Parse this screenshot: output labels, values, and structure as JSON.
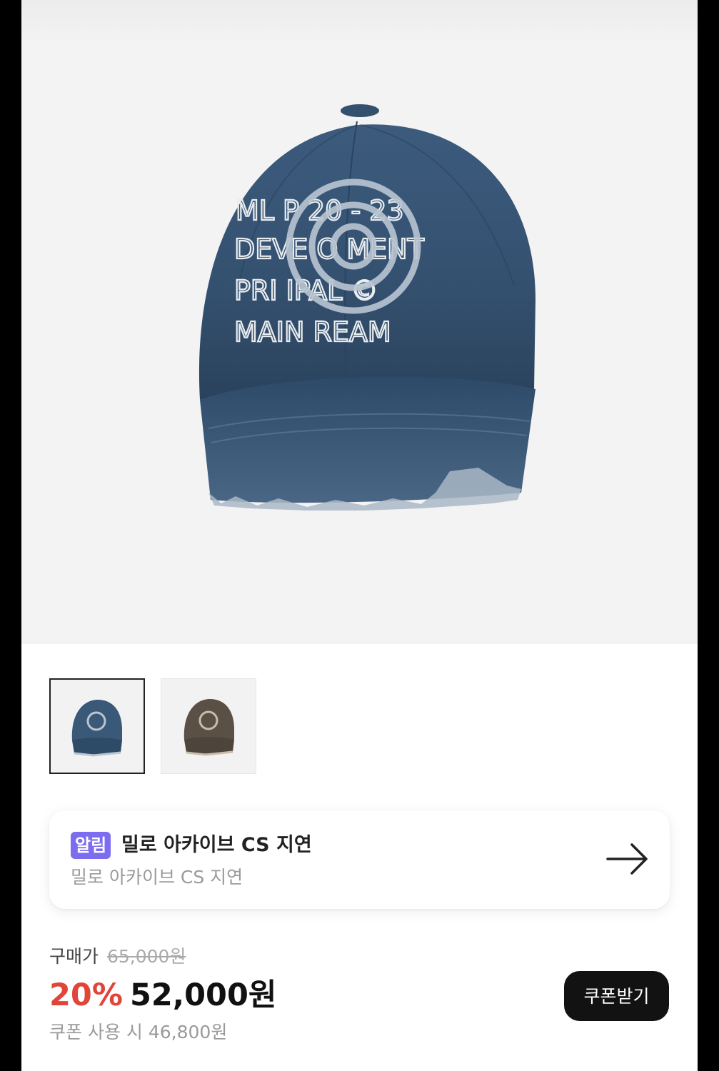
{
  "product": {
    "image_alt": "denim distressed ball cap",
    "cap_text_lines": [
      "ML P  20 - 23",
      "DEVE  O  MENT",
      "PRI   IPAL  ©",
      "MAIN   REAM"
    ]
  },
  "thumbnails": [
    {
      "variant": "blue denim",
      "selected": true
    },
    {
      "variant": "brown denim",
      "selected": false
    }
  ],
  "notice": {
    "badge": "알림",
    "title": "밀로 아카이브 CS 지연",
    "subtitle": "밀로 아카이브 CS 지연",
    "arrow_icon": "arrow-right-icon"
  },
  "price": {
    "label": "구매가",
    "original": "65,000원",
    "discount": "20%",
    "final": "52,000원",
    "coupon_note": "쿠폰 사용 시 46,800원",
    "coupon_button": "쿠폰받기"
  },
  "colors": {
    "badge": "#7c6cf0",
    "discount": "#e0453a",
    "button": "#121212"
  }
}
